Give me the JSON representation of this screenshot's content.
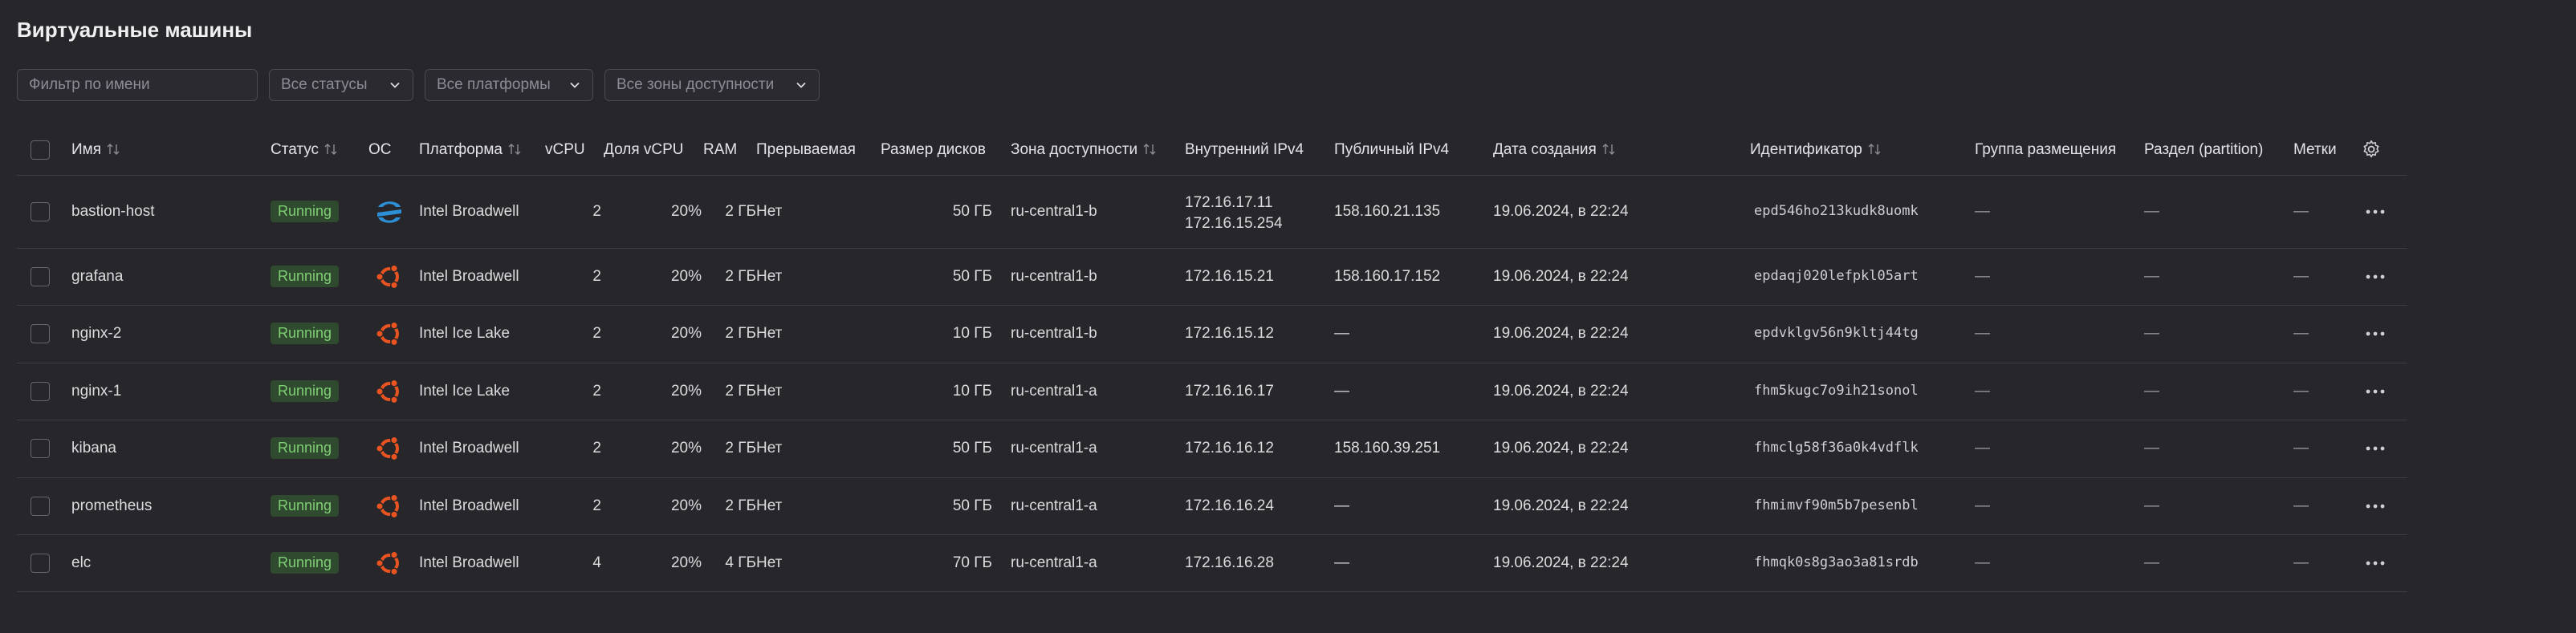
{
  "page": {
    "title": "Виртуальные машины"
  },
  "filters": {
    "name_placeholder": "Фильтр по имени",
    "status_label": "Все статусы",
    "platform_label": "Все платформы",
    "zone_label": "Все зоны доступности"
  },
  "columns": {
    "name": "Имя",
    "status": "Статус",
    "os": "ОС",
    "platform": "Платформа",
    "vcpu": "vCPU",
    "vcpu_share": "Доля vCPU",
    "ram": "RAM",
    "preemptible": "Прерываемая",
    "disk_size": "Размер дисков",
    "zone": "Зона доступности",
    "internal_ip": "Внутренний IPv4",
    "public_ip": "Публичный IPv4",
    "created": "Дата создания",
    "id": "Идентификатор",
    "placement_group": "Группа размещения",
    "partition": "Раздел (partition)",
    "labels": "Метки"
  },
  "colors": {
    "running_bg": "#2f4a2e",
    "running_fg": "#7fcf74",
    "ubuntu": "#e95420",
    "astra": "#2d8fd6"
  },
  "rows": [
    {
      "name": "bastion-host",
      "status": "Running",
      "os_icon": "astra-linux-icon",
      "platform": "Intel Broadwell",
      "vcpu": "2",
      "vcpu_share": "20%",
      "ram": "2 ГБ",
      "preemptible": "Нет",
      "disk": "50 ГБ",
      "zone": "ru-central1-b",
      "internal_ip": "172.16.17.11",
      "internal_ip2": "172.16.15.254",
      "public_ip": "158.160.21.135",
      "created": "19.06.2024, в 22:24",
      "id": "epd546ho213kudk8uomk",
      "placement": "—",
      "partition": "—",
      "labels": "—"
    },
    {
      "name": "grafana",
      "status": "Running",
      "os_icon": "ubuntu-icon",
      "platform": "Intel Broadwell",
      "vcpu": "2",
      "vcpu_share": "20%",
      "ram": "2 ГБ",
      "preemptible": "Нет",
      "disk": "50 ГБ",
      "zone": "ru-central1-b",
      "internal_ip": "172.16.15.21",
      "public_ip": "158.160.17.152",
      "created": "19.06.2024, в 22:24",
      "id": "epdaqj020lefpkl05art",
      "placement": "—",
      "partition": "—",
      "labels": "—"
    },
    {
      "name": "nginx-2",
      "status": "Running",
      "os_icon": "ubuntu-icon",
      "platform": "Intel Ice Lake",
      "vcpu": "2",
      "vcpu_share": "20%",
      "ram": "2 ГБ",
      "preemptible": "Нет",
      "disk": "10 ГБ",
      "zone": "ru-central1-b",
      "internal_ip": "172.16.15.12",
      "public_ip": "—",
      "created": "19.06.2024, в 22:24",
      "id": "epdvklgv56n9kltj44tg",
      "placement": "—",
      "partition": "—",
      "labels": "—"
    },
    {
      "name": "nginx-1",
      "status": "Running",
      "os_icon": "ubuntu-icon",
      "platform": "Intel Ice Lake",
      "vcpu": "2",
      "vcpu_share": "20%",
      "ram": "2 ГБ",
      "preemptible": "Нет",
      "disk": "10 ГБ",
      "zone": "ru-central1-a",
      "internal_ip": "172.16.16.17",
      "public_ip": "—",
      "created": "19.06.2024, в 22:24",
      "id": "fhm5kugc7o9ih21sonol",
      "placement": "—",
      "partition": "—",
      "labels": "—"
    },
    {
      "name": "kibana",
      "status": "Running",
      "os_icon": "ubuntu-icon",
      "platform": "Intel Broadwell",
      "vcpu": "2",
      "vcpu_share": "20%",
      "ram": "2 ГБ",
      "preemptible": "Нет",
      "disk": "50 ГБ",
      "zone": "ru-central1-a",
      "internal_ip": "172.16.16.12",
      "public_ip": "158.160.39.251",
      "created": "19.06.2024, в 22:24",
      "id": "fhmclg58f36a0k4vdflk",
      "placement": "—",
      "partition": "—",
      "labels": "—"
    },
    {
      "name": "prometheus",
      "status": "Running",
      "os_icon": "ubuntu-icon",
      "platform": "Intel Broadwell",
      "vcpu": "2",
      "vcpu_share": "20%",
      "ram": "2 ГБ",
      "preemptible": "Нет",
      "disk": "50 ГБ",
      "zone": "ru-central1-a",
      "internal_ip": "172.16.16.24",
      "public_ip": "—",
      "created": "19.06.2024, в 22:24",
      "id": "fhmimvf90m5b7pesenbl",
      "placement": "—",
      "partition": "—",
      "labels": "—"
    },
    {
      "name": "elc",
      "status": "Running",
      "os_icon": "ubuntu-icon",
      "platform": "Intel Broadwell",
      "vcpu": "4",
      "vcpu_share": "20%",
      "ram": "4 ГБ",
      "preemptible": "Нет",
      "disk": "70 ГБ",
      "zone": "ru-central1-a",
      "internal_ip": "172.16.16.28",
      "public_ip": "—",
      "created": "19.06.2024, в 22:24",
      "id": "fhmqk0s8g3ao3a81srdb",
      "placement": "—",
      "partition": "—",
      "labels": "—"
    }
  ]
}
